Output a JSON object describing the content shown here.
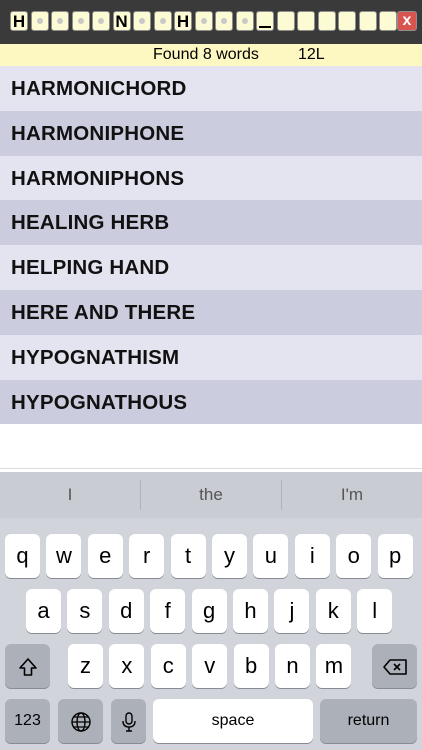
{
  "pattern": {
    "tiles": [
      {
        "type": "letter",
        "char": "H"
      },
      {
        "type": "dot"
      },
      {
        "type": "dot"
      },
      {
        "type": "dot"
      },
      {
        "type": "dot"
      },
      {
        "type": "letter",
        "char": "N"
      },
      {
        "type": "dot"
      },
      {
        "type": "dot"
      },
      {
        "type": "letter",
        "char": "H"
      },
      {
        "type": "dot"
      },
      {
        "type": "dot"
      },
      {
        "type": "dot"
      },
      {
        "type": "cursor"
      },
      {
        "type": "empty"
      },
      {
        "type": "empty"
      },
      {
        "type": "empty"
      },
      {
        "type": "empty"
      },
      {
        "type": "empty"
      },
      {
        "type": "empty"
      }
    ],
    "close_label": "x"
  },
  "status": {
    "found_text": "Found 8 words",
    "length_text": "12L"
  },
  "results": [
    "HARMONICHORD",
    "HARMONIPHONE",
    "HARMONIPHONS",
    "HEALING HERB",
    "HELPING HAND",
    "HERE AND THERE",
    "HYPOGNATHISM",
    "HYPOGNATHOUS"
  ],
  "keyboard": {
    "suggestions": [
      "I",
      "the",
      "I'm"
    ],
    "row1": [
      "q",
      "w",
      "e",
      "r",
      "t",
      "y",
      "u",
      "i",
      "o",
      "p"
    ],
    "row2": [
      "a",
      "s",
      "d",
      "f",
      "g",
      "h",
      "j",
      "k",
      "l"
    ],
    "row3": [
      "z",
      "x",
      "c",
      "v",
      "b",
      "n",
      "m"
    ],
    "numbers_label": "123",
    "space_label": "space",
    "return_label": "return",
    "icons": {
      "shift": "shift-icon",
      "backspace": "backspace-icon",
      "globe": "globe-icon",
      "mic": "microphone-icon"
    }
  },
  "colors": {
    "tile_fill": "#fdfbd3",
    "status_bg": "#fdf7c2",
    "row_light": "#e4e4f0",
    "row_dark": "#ccccdf",
    "close_red": "#d9534f"
  }
}
